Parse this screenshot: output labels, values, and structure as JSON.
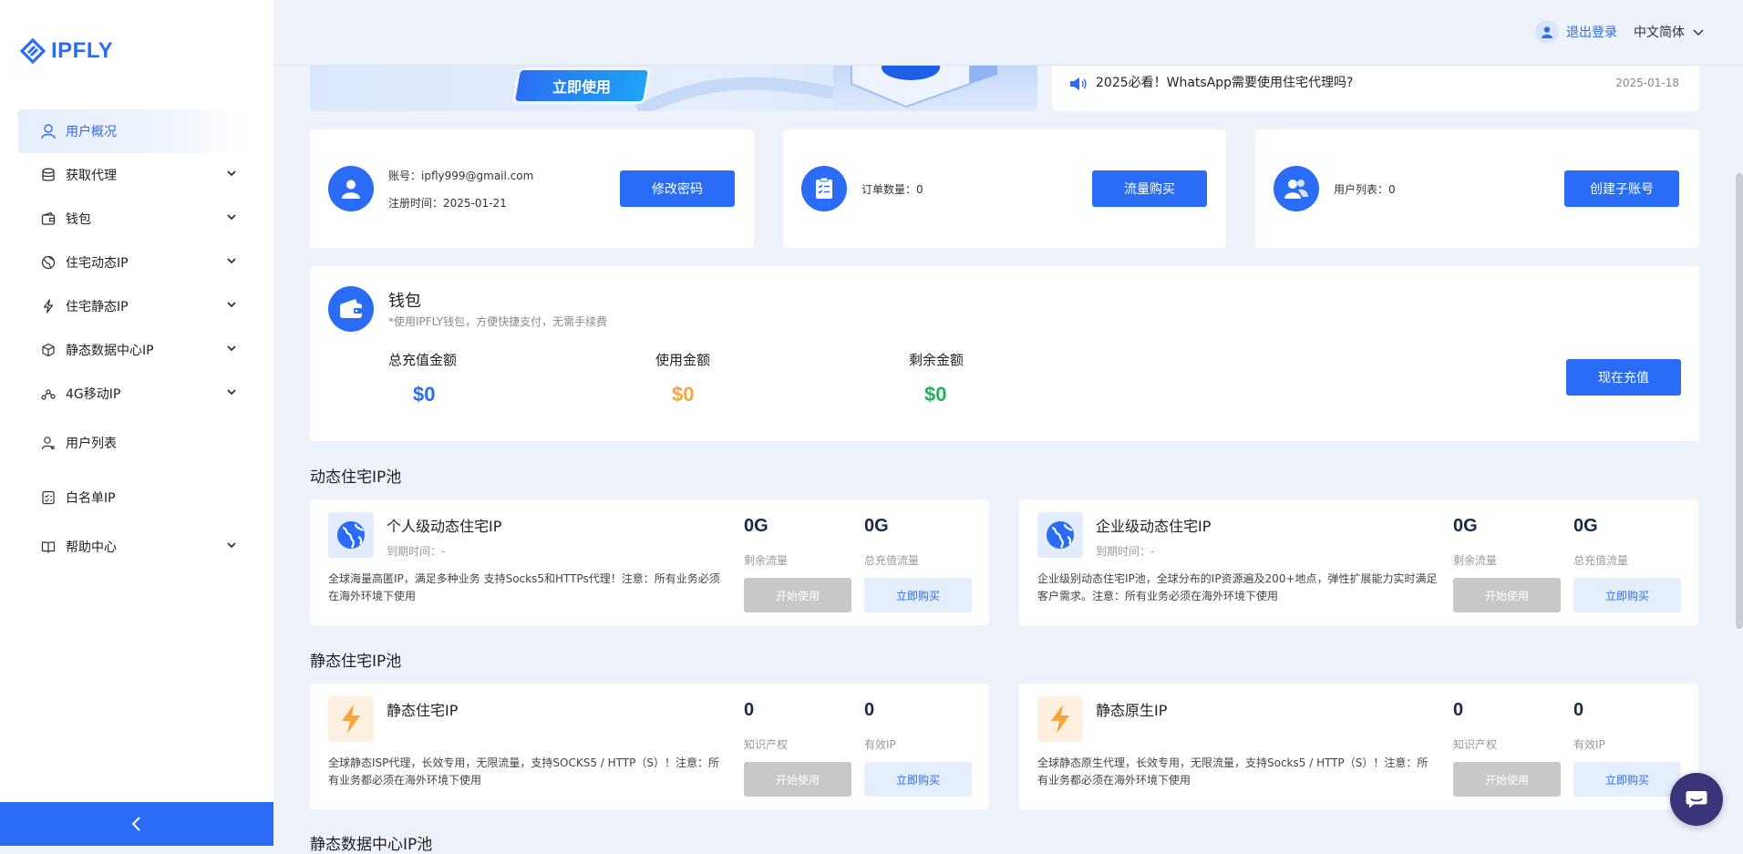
{
  "brand": {
    "name": "IPFLY",
    "color": "#2a6cf5"
  },
  "sidebar": {
    "items": [
      {
        "label": "用户概况",
        "icon": "user-icon",
        "active": true,
        "expandable": false
      },
      {
        "label": "获取代理",
        "icon": "database-icon",
        "active": false,
        "expandable": true
      },
      {
        "label": "钱包",
        "icon": "wallet-icon",
        "active": false,
        "expandable": true
      },
      {
        "label": "住宅动态IP",
        "icon": "globe-icon",
        "active": false,
        "expandable": true
      },
      {
        "label": "住宅静态IP",
        "icon": "lightning-icon",
        "active": false,
        "expandable": true
      },
      {
        "label": "静态数据中心IP",
        "icon": "cube-icon",
        "active": false,
        "expandable": true
      },
      {
        "label": "4G移动IP",
        "icon": "network-icon",
        "active": false,
        "expandable": true
      },
      {
        "label": "用户列表",
        "icon": "user-list-icon",
        "active": false,
        "expandable": false
      },
      {
        "label": "白名单IP",
        "icon": "checklist-icon",
        "active": false,
        "expandable": false
      },
      {
        "label": "帮助中心",
        "icon": "book-icon",
        "active": false,
        "expandable": true
      }
    ]
  },
  "header": {
    "logout": "退出登录",
    "language": "中文简体"
  },
  "banner": {
    "button": "立即使用"
  },
  "news": {
    "title": "2025必看！WhatsApp需要使用住宅代理吗?",
    "date": "2025-01-18"
  },
  "account_card": {
    "account": "账号：ipfly999@gmail.com",
    "registered": "注册时间：2025-01-21",
    "button": "修改密码"
  },
  "order_card": {
    "orders": "订单数量：0",
    "button": "流量购买"
  },
  "users_card": {
    "users": "用户列表：0",
    "button": "创建子账号"
  },
  "wallet": {
    "title": "钱包",
    "subtitle": "*使用IPFLY钱包，方便快捷支付，无需手续费",
    "total_label": "总充值金额",
    "total_value": "$0",
    "used_label": "使用金额",
    "used_value": "$0",
    "remaining_label": "剩余金额",
    "remaining_value": "$0",
    "button": "现在充值",
    "colors": {
      "total": "#2a6cf5",
      "used": "#f7a43a",
      "remaining": "#1fb25a"
    }
  },
  "dynamic_pool": {
    "title": "动态住宅IP池",
    "cards": [
      {
        "name": "个人级动态住宅IP",
        "expiry": "到期时间：-",
        "desc": "全球海量高匿IP，满足多种业务 支持Socks5和HTTPs代理！注意：所有业务必须在海外环境下使用",
        "stat1_value": "0G",
        "stat1_label": "剩余流量",
        "stat2_value": "0G",
        "stat2_label": "总充值流量",
        "start": "开始使用",
        "buy": "立即购买"
      },
      {
        "name": "企业级动态住宅IP",
        "expiry": "到期时间：-",
        "desc": "企业级别动态住宅IP池，全球分布的IP资源遍及200+地点，弹性扩展能力实时满足客户需求。注意：所有业务必须在海外环境下使用",
        "stat1_value": "0G",
        "stat1_label": "剩余流量",
        "stat2_value": "0G",
        "stat2_label": "总充值流量",
        "start": "开始使用",
        "buy": "立即购买"
      }
    ]
  },
  "static_pool": {
    "title": "静态住宅IP池",
    "cards": [
      {
        "name": "静态住宅IP",
        "desc": "全球静态ISP代理，长效专用，无限流量，支持SOCKS5 / HTTP（S）！注意：所有业务都必须在海外环境下使用",
        "stat1_value": "0",
        "stat1_label": "知识产权",
        "stat2_value": "0",
        "stat2_label": "有效IP",
        "start": "开始使用",
        "buy": "立即购买"
      },
      {
        "name": "静态原生IP",
        "desc": "全球静态原生代理，长效专用，无限流量，支持Socks5 / HTTP（S）！注意：所有业务都必须在海外环境下使用",
        "stat1_value": "0",
        "stat1_label": "知识产权",
        "stat2_value": "0",
        "stat2_label": "有效IP",
        "start": "开始使用",
        "buy": "立即购买"
      }
    ]
  },
  "datacenter_pool": {
    "title": "静态数据中心IP池"
  }
}
